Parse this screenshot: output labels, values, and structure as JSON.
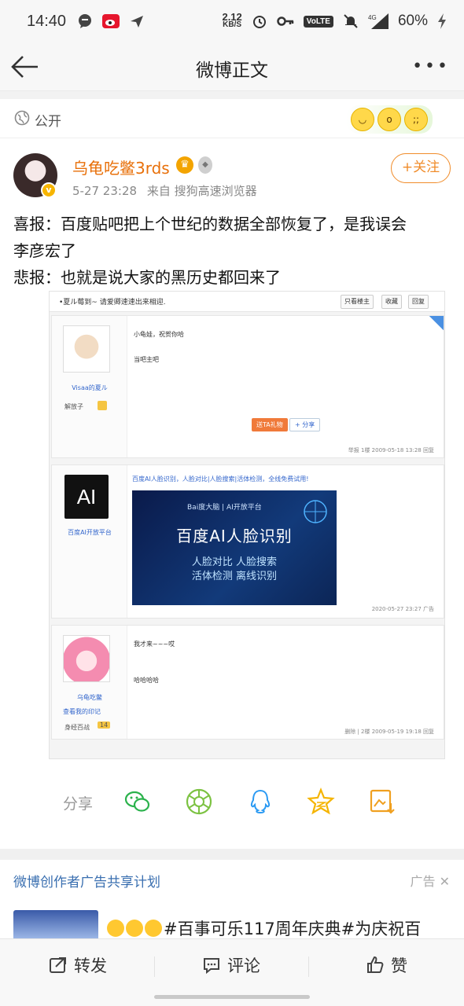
{
  "status_bar": {
    "time": "14:40",
    "net_speed_value": "2.12",
    "net_speed_unit": "KB/S",
    "volte": "VoLTE",
    "signal": "4G",
    "battery": "60%"
  },
  "nav": {
    "title": "微博正文",
    "more": "•••"
  },
  "visibility": {
    "label": "公开"
  },
  "post": {
    "author": "乌龟吃鳖3rds",
    "date": "5-27 23:28",
    "source": "来自 搜狗高速浏览器",
    "follow_label": "+关注",
    "text_line1": "喜报：百度贴吧把上个世纪的数据全部恢复了，是我误会",
    "text_line2": "李彦宏了",
    "text_line3": "悲报：也就是说大家的黑历史都回来了"
  },
  "embed": {
    "top_title": "•夏ル莓到~ 请爱卿速速出来相迎.",
    "top_buttons": [
      "只看楼主",
      "收藏",
      "回复"
    ],
    "post1": {
      "user": "Visaa的夏ル",
      "rank": "解放子",
      "line1": "小龟娃，祝贺你哈",
      "line2": "当吧主吧",
      "footer": "举报 1楼 2009-05-18 13:28 回复",
      "btn1": "送TA礼物",
      "btn2": "+ 分享"
    },
    "post2": {
      "user": "百度AI开放平台",
      "logo": "AI",
      "headline": "百度AI人脸识别，人脸对比|人脸搜索|活体检测，全线免费试用!",
      "banner_logo": "Bai度大脑 | AI开放平台",
      "banner_title": "百度AI人脸识别",
      "banner_l1": "人脸对比  人脸搜索",
      "banner_l2": "活体检测  离线识别",
      "footer": "2020-05-27 23:27 广告"
    },
    "post3": {
      "user": "乌龟吃鳖",
      "note": "查看我的印记",
      "rank": "身经百战",
      "level": "14",
      "line1": "我才来~~~哎",
      "line2": "哈哈哈哈",
      "footer": "删除 | 2楼 2009-05-19 19:18 回复"
    }
  },
  "share": {
    "label": "分享",
    "icons": [
      "wechat-icon",
      "moments-icon",
      "qq-icon",
      "qzone-icon",
      "save-image-icon"
    ]
  },
  "ad": {
    "title": "微博创作者广告共享计划",
    "tag": "广告",
    "text": "#百事可乐117周年庆典#为庆祝百"
  },
  "toolbar": {
    "repost": "转发",
    "comment": "评论",
    "like": "赞"
  },
  "colors": {
    "accent_orange": "#f08c2a",
    "author_orange": "#e8700a",
    "link_blue": "#3a6fb0"
  }
}
